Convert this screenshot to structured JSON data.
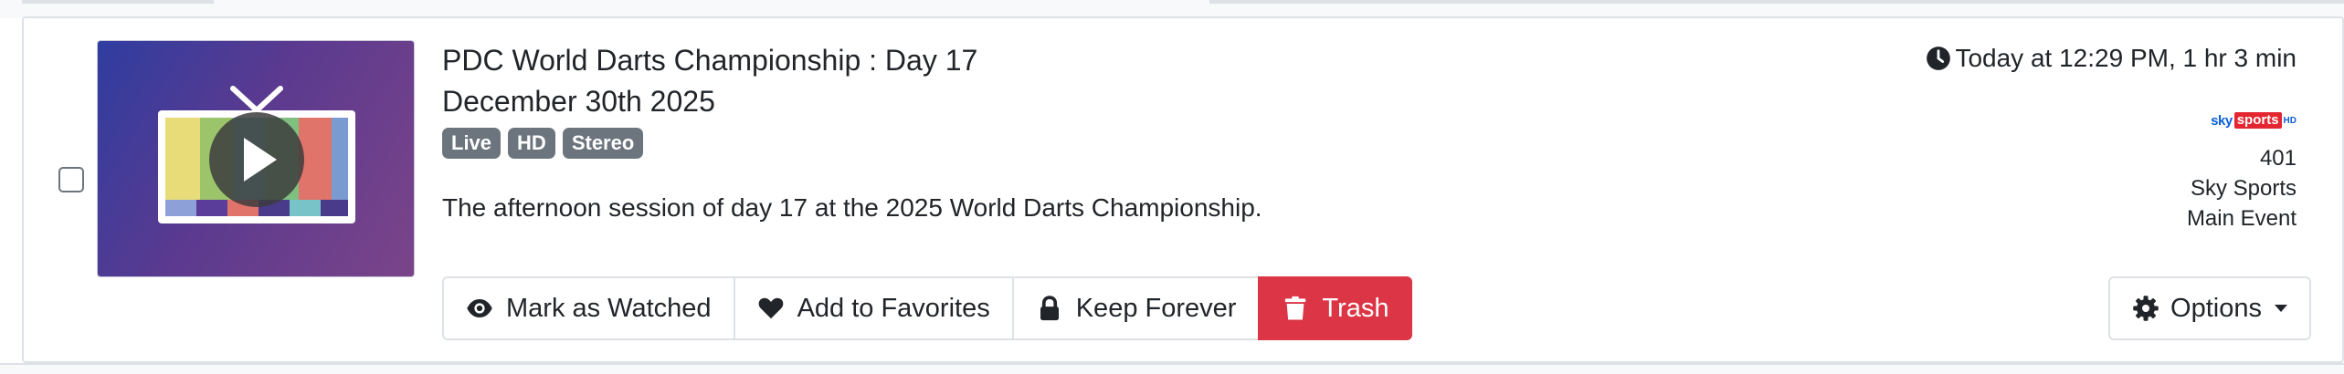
{
  "recording": {
    "title": "PDC World Darts Championship : Day 17",
    "subtitle": "December 30th 2025",
    "badges": [
      "Live",
      "HD",
      "Stereo"
    ],
    "description": "The afternoon session of day 17 at the 2025 World Darts Championship.",
    "timestamp": "Today at 12:29 PM, 1 hr 3 min",
    "channel": {
      "logo_text": [
        "sky",
        "sports",
        "HD"
      ],
      "number": "401",
      "name_line1": "Sky Sports",
      "name_line2": "Main Event"
    },
    "selected": false
  },
  "actions": {
    "mark_watched": "Mark as Watched",
    "add_favorites": "Add to Favorites",
    "keep_forever": "Keep Forever",
    "trash": "Trash",
    "options": "Options"
  },
  "icons": {
    "thumbnail": "tv-play-icon",
    "timestamp": "clock-icon",
    "mark_watched": "eye-icon",
    "add_favorites": "heart-icon",
    "keep_forever": "lock-icon",
    "trash": "trash-icon",
    "options": "gear-icon"
  },
  "colors": {
    "danger": "#dc3545",
    "badge": "#6c757d",
    "border": "#dee2e6"
  }
}
